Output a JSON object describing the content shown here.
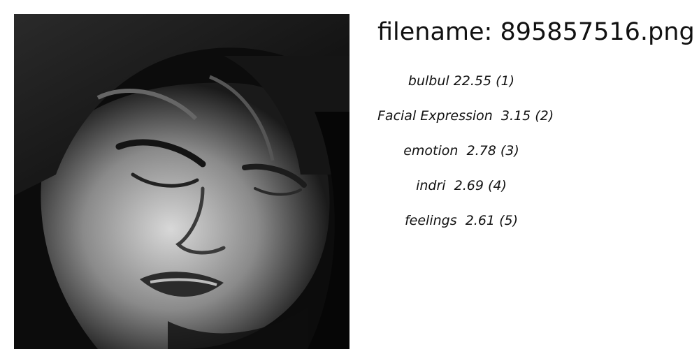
{
  "file": {
    "prefix": "filename:",
    "name": "895857516.png"
  },
  "photo": {
    "description_icon": "grayscale-face-photo"
  },
  "predictions": [
    {
      "label": "bulbul",
      "score": "22.55",
      "rank": "(1)"
    },
    {
      "label": "Facial Expression",
      "score": "3.15",
      "rank": "(2)"
    },
    {
      "label": "emotion",
      "score": "2.78",
      "rank": "(3)"
    },
    {
      "label": "indri",
      "score": "2.69",
      "rank": "(4)"
    },
    {
      "label": "feelings",
      "score": "2.61",
      "rank": "(5)"
    }
  ]
}
